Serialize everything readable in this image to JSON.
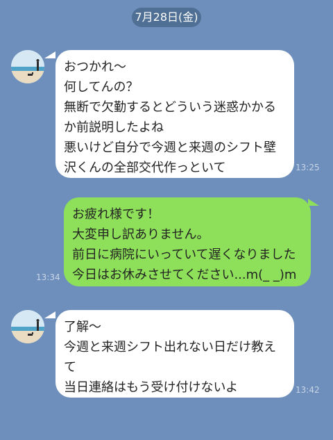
{
  "date_label": "7月28日(金)",
  "messages": [
    {
      "from": "them",
      "lines": [
        "おつかれ〜",
        "何してんの？",
        "無断で欠勤するとどういう迷惑かかる",
        "か前説明したよね",
        "悪いけど自分で今週と来週のシフト壁",
        "沢くんの全部交代作っといて"
      ],
      "time": "13:25"
    },
    {
      "from": "me",
      "lines": [
        "お疲れ様です！",
        "大変申し訳ありません。",
        "前日に病院にいっていて遅くなりました",
        "今日はお休みさせてください...m(_ _)m"
      ],
      "time": "13:34"
    },
    {
      "from": "them",
      "lines": [
        "了解〜",
        "今週と来週シフト出れない日だけ教え",
        "て",
        "当日連絡はもう受け付けないよ"
      ],
      "time": "13:42"
    }
  ],
  "colors": {
    "background": "#6e8fbb",
    "incoming_bubble": "#ffffff",
    "outgoing_bubble": "#8ee05a",
    "date_pill": "#4f6f95"
  }
}
